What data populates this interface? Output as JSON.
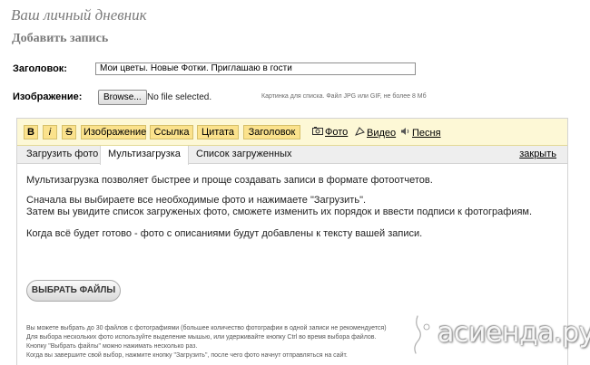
{
  "page": {
    "title": "Ваш личный дневник",
    "subtitle": "Добавить запись"
  },
  "form": {
    "title_label": "Заголовок:",
    "title_value": "Мои цветы. Новые Фотки. Приглашаю в гости",
    "image_label": "Изображение:",
    "browse_label": "Browse...",
    "file_status": "No file selected.",
    "file_hint": "Картинка для списка. Файл JPG или GIF, не более 8 Мб"
  },
  "toolbar": {
    "buttons": [
      "B",
      "i",
      "S",
      "Изображение",
      "Ссылка",
      "Цитата",
      "Заголовок"
    ],
    "links": [
      {
        "icon": "camera-icon",
        "label": "Фото"
      },
      {
        "icon": "video-icon",
        "label": "Видео"
      },
      {
        "icon": "speaker-icon",
        "label": "Песня"
      }
    ]
  },
  "tabs": {
    "items": [
      "Загрузить фото",
      "Мультизагрузка",
      "Список загруженных"
    ],
    "active": "Мультизагрузка",
    "close_label": "закрыть"
  },
  "content": {
    "lines": [
      "Мультизагрузка позволяет быстрее и проще создавать записи в формате фотоотчетов.",
      "Сначала вы выбираете все необходимые фото и нажимаете \"Загрузить\".",
      "Затем вы увидите список загруженых фото, сможете изменить их порядок и ввести подписи к фотографиям.",
      "Когда всё будет готово - фото с описаниями будут добавлены к тексту вашей записи."
    ],
    "select_button": "ВЫБРАТЬ ФАЙЛЫ",
    "notes": [
      "Вы можете выбрать до 30 файлов с фотографиями (большее количество фотографии в одной записи не рекомендуется)",
      "Для выбора нескольких фото используйте выделение мышью, или удерживайте кнопку Ctrl во время выбора файлов.",
      "Кнопку \"Выбрать файлы\" можно нажимать несколько раз.",
      "Когда вы завершите свой выбор, нажмите кнопку \"Загрузить\", после чего фото начнут отправляться на сайт."
    ]
  },
  "watermark": {
    "text": "асиенда.ру"
  }
}
